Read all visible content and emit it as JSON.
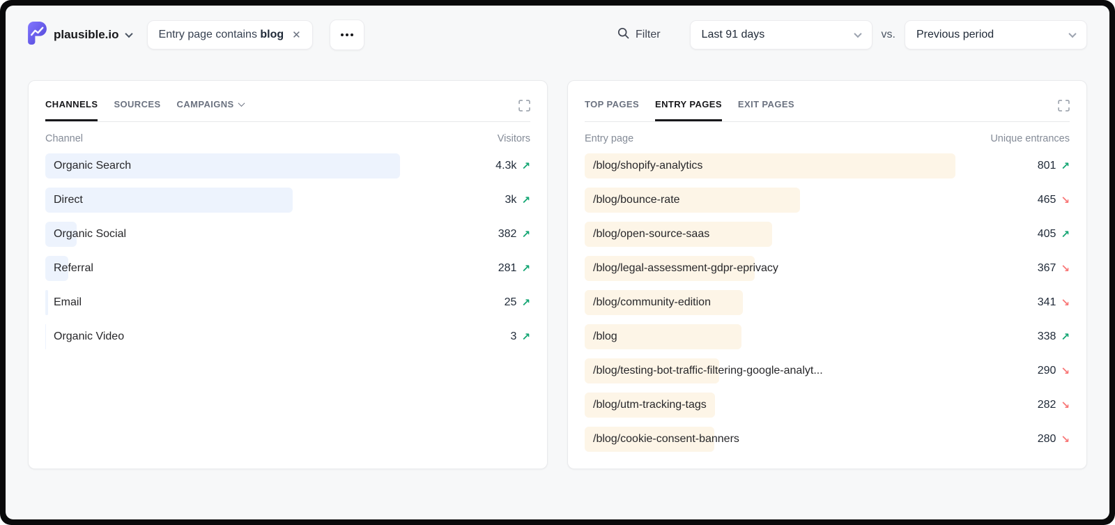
{
  "header": {
    "site": "plausible.io",
    "filter_pill": {
      "prefix": "Entry page contains",
      "value": "blog",
      "close": "✕"
    },
    "filter_label": "Filter",
    "date_range": "Last 91 days",
    "vs_label": "vs.",
    "comparison": "Previous period"
  },
  "colors": {
    "blue_bar": "#edf3fd",
    "orange_bar": "#fdf5e7",
    "trend_up": "#12a572",
    "trend_down": "#f87676",
    "active_tab": "#18181b"
  },
  "channels_panel": {
    "tabs": [
      {
        "label": "Channels",
        "active": true
      },
      {
        "label": "Sources"
      },
      {
        "label": "Campaigns",
        "has_chevron": true
      }
    ],
    "col_left": "Channel",
    "col_right": "Visitors",
    "rows": [
      {
        "label": "Organic Search",
        "value": "4.3k",
        "trend": "up",
        "bar_pct": 73.2
      },
      {
        "label": "Direct",
        "value": "3k",
        "trend": "up",
        "bar_pct": 51.0
      },
      {
        "label": "Organic Social",
        "value": "382",
        "trend": "up",
        "bar_pct": 6.5
      },
      {
        "label": "Referral",
        "value": "281",
        "trend": "up",
        "bar_pct": 4.8
      },
      {
        "label": "Email",
        "value": "25",
        "trend": "up",
        "bar_pct": 0.6
      },
      {
        "label": "Organic Video",
        "value": "3",
        "trend": "up",
        "bar_pct": 0.15
      }
    ]
  },
  "pages_panel": {
    "tabs": [
      {
        "label": "Top Pages"
      },
      {
        "label": "Entry Pages",
        "active": true
      },
      {
        "label": "Exit Pages"
      }
    ],
    "col_left": "Entry page",
    "col_right": "Unique entrances",
    "rows": [
      {
        "label": "/blog/shopify-analytics",
        "value": "801",
        "trend": "up",
        "bar_pct": 76.5
      },
      {
        "label": "/blog/bounce-rate",
        "value": "465",
        "trend": "down",
        "bar_pct": 44.4
      },
      {
        "label": "/blog/open-source-saas",
        "value": "405",
        "trend": "up",
        "bar_pct": 38.7
      },
      {
        "label": "/blog/legal-assessment-gdpr-eprivacy",
        "value": "367",
        "trend": "down",
        "bar_pct": 35.0
      },
      {
        "label": "/blog/community-edition",
        "value": "341",
        "trend": "down",
        "bar_pct": 32.6
      },
      {
        "label": "/blog",
        "value": "338",
        "trend": "up",
        "bar_pct": 32.3
      },
      {
        "label": "/blog/testing-bot-traffic-filtering-google-analyt...",
        "value": "290",
        "trend": "down",
        "bar_pct": 27.7
      },
      {
        "label": "/blog/utm-tracking-tags",
        "value": "282",
        "trend": "down",
        "bar_pct": 26.9
      },
      {
        "label": "/blog/cookie-consent-banners",
        "value": "280",
        "trend": "down",
        "bar_pct": 26.7
      }
    ]
  }
}
